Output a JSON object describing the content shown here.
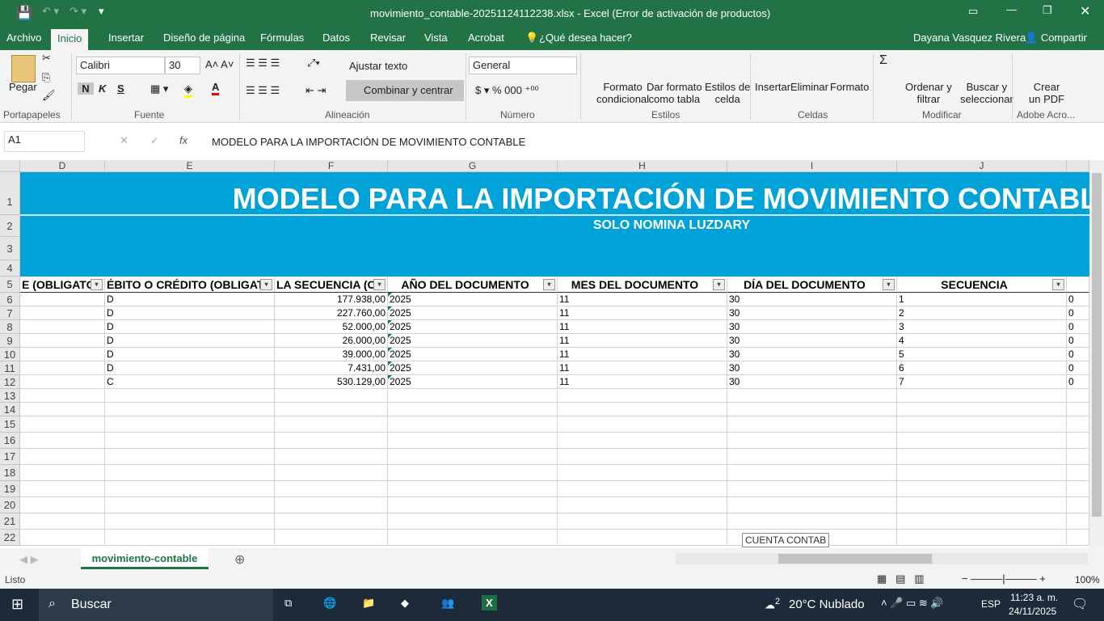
{
  "window": {
    "title": "movimiento_contable-20251124112238.xlsx - Excel (Error de activación de productos)"
  },
  "tabs": [
    "Archivo",
    "Inicio",
    "Insertar",
    "Diseño de página",
    "Fórmulas",
    "Datos",
    "Revisar",
    "Vista",
    "Acrobat"
  ],
  "tell_me": "¿Qué desea hacer?",
  "user": "Dayana Vasquez Rivera",
  "share": "Compartir",
  "ribbon": {
    "paste": "Pegar",
    "font": "Calibri",
    "size": "30",
    "bold": "N",
    "italic": "K",
    "underline": "S",
    "wrap": "Ajustar texto",
    "merge": "Combinar y centrar",
    "format": "General",
    "cond1": "Formato",
    "cond2": "condicional",
    "table1": "Dar formato",
    "table2": "como tabla",
    "styles1": "Estilos de",
    "styles2": "celda",
    "insert": "Insertar",
    "delete": "Eliminar",
    "fmt": "Formato",
    "sort1": "Ordenar y",
    "sort2": "filtrar",
    "find1": "Buscar y",
    "find2": "seleccionar",
    "pdf1": "Crear",
    "pdf2": "un PDF",
    "groups": [
      "Portapapeles",
      "Fuente",
      "Alineación",
      "Número",
      "Estilos",
      "Celdas",
      "Modificar",
      "Adobe Acro..."
    ]
  },
  "formula_bar": {
    "name_box": "A1",
    "fx": "fx",
    "value": "MODELO PARA LA IMPORTACIÓN DE MOVIMIENTO CONTABLE"
  },
  "columns": [
    "D",
    "E",
    "F",
    "G",
    "H",
    "I",
    "J"
  ],
  "rows": [
    "1",
    "2",
    "3",
    "4",
    "5",
    "6",
    "7",
    "8",
    "9",
    "10",
    "11",
    "12",
    "13",
    "14",
    "15",
    "16",
    "17",
    "18",
    "19",
    "20",
    "21",
    "22"
  ],
  "sheet": {
    "title": "MODELO PARA LA IMPORTACIÓN DE MOVIMIENTO CONTABLE",
    "subtitle": "SOLO NOMINA LUZDARY",
    "headers": [
      "E   (OBLIGATO",
      "ÉBITO O CRÉDITO (OBLIGATO",
      "LA SECUENCIA   (O",
      "AÑO DEL DOCUMENTO",
      "MES DEL DOCUMENTO",
      "DÍA DEL DOCUMENTO",
      "SECUENCIA"
    ],
    "data": [
      [
        "D",
        "177.938,00",
        "2025",
        "11",
        "30",
        "1",
        "0"
      ],
      [
        "D",
        "227.760,00",
        "2025",
        "11",
        "30",
        "2",
        "0"
      ],
      [
        "D",
        "52.000,00",
        "2025",
        "11",
        "30",
        "3",
        "0"
      ],
      [
        "D",
        "26.000,00",
        "2025",
        "11",
        "30",
        "4",
        "0"
      ],
      [
        "D",
        "39.000,00",
        "2025",
        "11",
        "30",
        "5",
        "0"
      ],
      [
        "D",
        "7.431,00",
        "2025",
        "11",
        "30",
        "6",
        "0"
      ],
      [
        "C",
        "530.129,00",
        "2025",
        "11",
        "30",
        "7",
        "0"
      ]
    ],
    "tooltip": "CUENTA CONTAB"
  },
  "sheet_tab": "movimiento-contable",
  "status": {
    "ready": "Listo",
    "zoom": "100%"
  },
  "taskbar": {
    "search": "Buscar",
    "weather": "20°C  Nublado",
    "lang": "ESP",
    "time": "11:23 a. m.",
    "date": "24/11/2025",
    "badge": "2"
  },
  "colors": {
    "excel_green": "#217346",
    "banner": "#00a2d8"
  }
}
